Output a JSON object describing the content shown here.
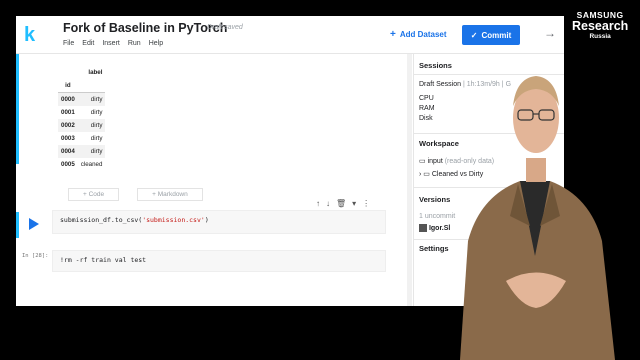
{
  "header": {
    "title": "Fork of Baseline in PyTorch",
    "draft_status": "Draft saved",
    "menu": [
      "File",
      "Edit",
      "Insert",
      "Run",
      "Help"
    ],
    "add_dataset_label": "Add Dataset",
    "commit_label": "Commit",
    "logo_letter": "k"
  },
  "dataframe": {
    "column_label": "label",
    "index_name": "id",
    "rows": [
      {
        "id": "0000",
        "label": "dirty"
      },
      {
        "id": "0001",
        "label": "dirty"
      },
      {
        "id": "0002",
        "label": "dirty"
      },
      {
        "id": "0003",
        "label": "dirty"
      },
      {
        "id": "0004",
        "label": "dirty"
      },
      {
        "id": "0005",
        "label": "cleaned"
      }
    ]
  },
  "notebook": {
    "add_code_label": "+ Code",
    "add_markdown_label": "+ Markdown",
    "cell1_code_prefix": "submission_df.to_csv(",
    "cell1_code_string": "'submission.csv'",
    "cell1_code_suffix": ")",
    "cell2_prompt": "In [28]:",
    "cell2_code": "!rm -rf train val test"
  },
  "panel": {
    "sessions_heading": "Sessions",
    "session_name": "Draft Session",
    "session_time": "1h:13m/9h",
    "session_gpu": "G",
    "resources": [
      "CPU",
      "RAM",
      "Disk"
    ],
    "workspace_heading": "Workspace",
    "input_label": "input",
    "input_note": "(read-only data)",
    "dataset_item": "Cleaned vs Dirty",
    "versions_heading": "Versions",
    "versions_uncommitted": "1 uncommit",
    "version_author": "Igor.Sl",
    "settings_heading": "Settings"
  },
  "brand": {
    "line1": "SAMSUNG",
    "line2": "Research",
    "line3": "Russia"
  },
  "colors": {
    "accent": "#20beff",
    "primary": "#1a73e8"
  }
}
